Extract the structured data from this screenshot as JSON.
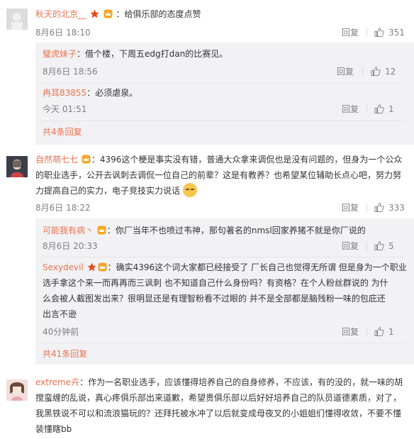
{
  "comments": [
    {
      "user": "秋天的北京__",
      "text": "：给俱乐部的态度点赞",
      "time": "8月6日 18:10",
      "reply_label": "回复",
      "likes": "351",
      "replies": [
        {
          "user": "璧虎妹子",
          "text": "：借个楼，下周五edg打dan的比赛见。",
          "time": "8月6日 18:56",
          "reply_label": "回复",
          "likes": "12"
        },
        {
          "user": "冉耳83855",
          "text": "：必须虐泉。",
          "time": "今天 01:51",
          "reply_label": "回复",
          "likes": "1"
        }
      ],
      "more": "共4条回复"
    },
    {
      "user": "自然萌七七",
      "text_lines": [
        "：4396这个梗是事实没有错，普通大众拿来调侃也是没有问题的，但身为一个公众",
        "的职业选手，公开去讽刺去调侃一位自己的前辈？这是有教养？也希望某位辅助长点心吧，努力努",
        "力提高自己的实力，电子竞技实力说话"
      ],
      "time": "8月6日 18:22",
      "reply_label": "回复",
      "likes": "333",
      "replies": [
        {
          "user": "可能我有病丶",
          "text": "：你厂当年不也喷过韦神，那句著名的nmsl回家养猪不就是你厂说的",
          "time": "8月6日 20:33",
          "reply_label": "回复",
          "likes": "5"
        },
        {
          "user": "Sexydevil",
          "text_lines": [
            "：确实4396这个词大家都已经接受了 厂长自己也觉得无所谓 但是身为一个职业",
            "选手拿这个来一而再再而三讽刺  也不知道自己什么身份吗？有资格？在个人粉丝群说的  为什",
            "么会被人截图发出来？很明显还是有理智粉看不过眼的  并不是全部都是脑残粉一味的包庇还",
            "出言不逊"
          ],
          "time": "40分钟前",
          "reply_label": "回复",
          "likes": "1"
        }
      ],
      "more": "共41条回复"
    },
    {
      "user": "extreme卉",
      "text_lines": [
        "：作为一名职业选手，应该懂得培养自己的自身修养，不应该，有的没的，就一味的胡",
        "搅蛮缠的乱说，真心疼俱乐部出来道歉，希望贵俱乐部以后好好培养自己的队员道德素质，对了，",
        "我黑铁说不可以和流浪猫玩的？还拜托被水冲了以后就变成母夜叉的小姐姐们懂得收敛，不要不懂",
        "装懂瞎bb"
      ]
    }
  ]
}
